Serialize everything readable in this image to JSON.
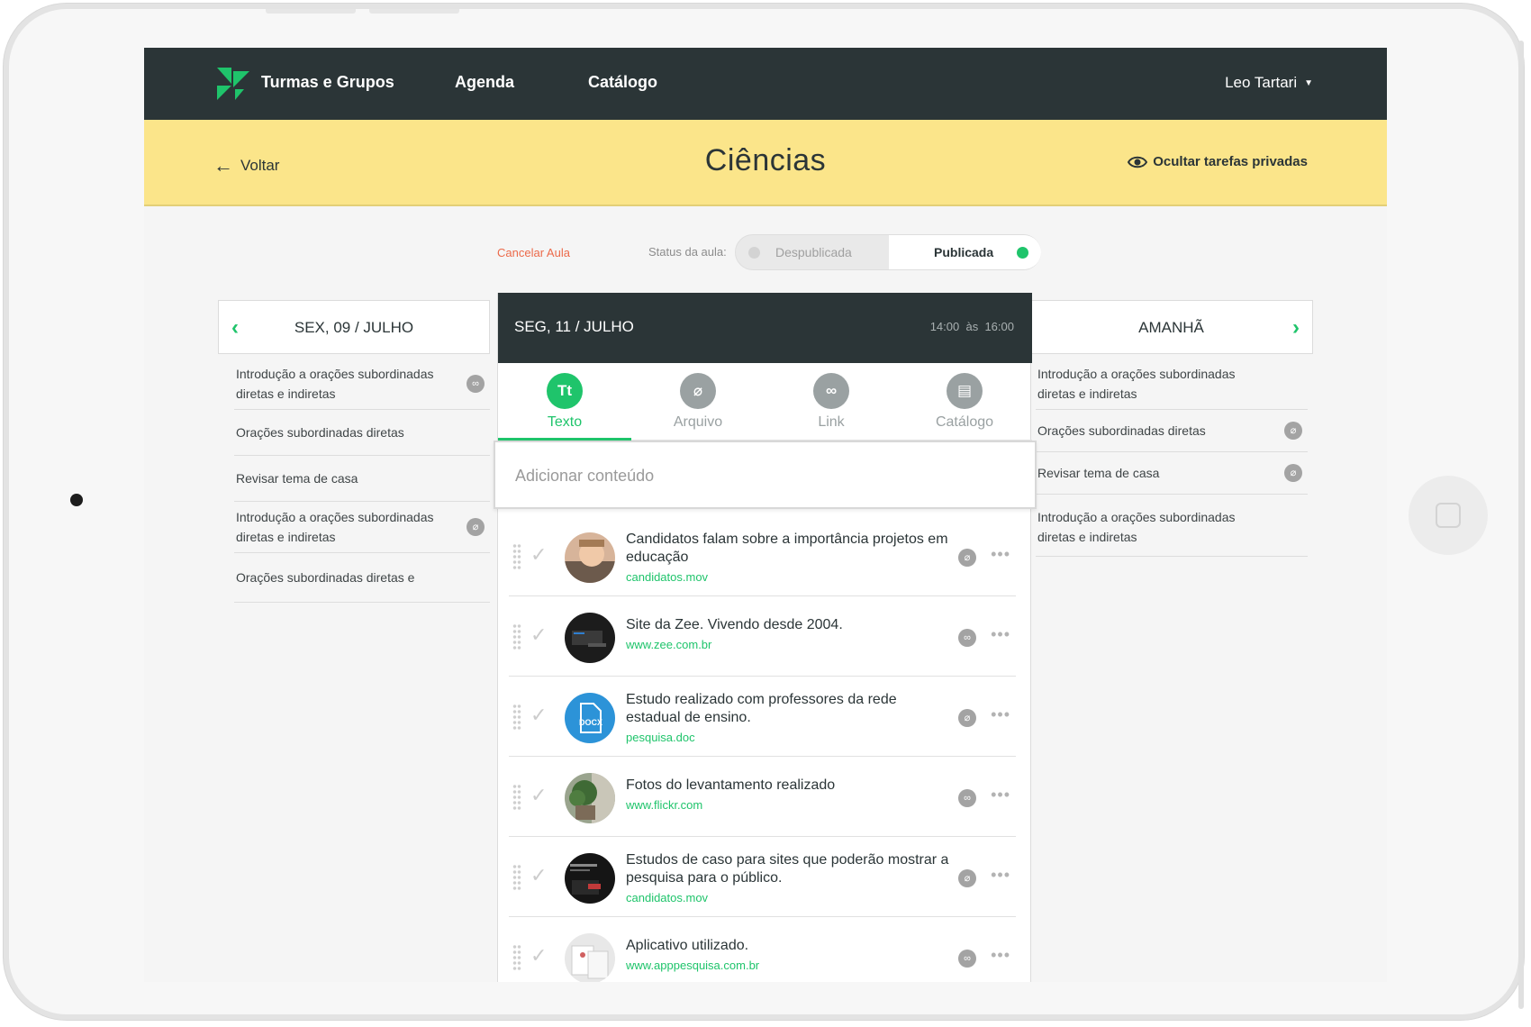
{
  "nav": {
    "brand": "Turmas e Grupos",
    "items": [
      "Agenda",
      "Catálogo"
    ],
    "user": "Leo Tartari"
  },
  "header": {
    "back": "Voltar",
    "title": "Ciências",
    "hide_private": "Ocultar tarefas privadas"
  },
  "status": {
    "cancel": "Cancelar Aula",
    "label": "Status da aula:",
    "off": "Despublicada",
    "on": "Publicada"
  },
  "left_day": {
    "title": "SEX, 09 / JULHO",
    "items": [
      {
        "text": "Introdução a orações subordinadas diretas e indiretas",
        "icon": "link-icon"
      },
      {
        "text": "Orações subordinadas diretas",
        "icon": ""
      },
      {
        "text": "Revisar tema de casa",
        "icon": ""
      },
      {
        "text": "Introdução a orações subordinadas diretas e indiretas",
        "icon": "paperclip-icon"
      },
      {
        "text": "Orações subordinadas diretas e",
        "icon": ""
      }
    ]
  },
  "right_day": {
    "title": "AMANHÃ",
    "items": [
      {
        "text": "Introdução a orações subordinadas diretas e indiretas",
        "icon": ""
      },
      {
        "text": "Orações subordinadas diretas",
        "icon": "paperclip-icon"
      },
      {
        "text": "Revisar tema de casa",
        "icon": "paperclip-icon"
      },
      {
        "text": "Introdução a orações subordinadas diretas e indiretas",
        "icon": ""
      }
    ]
  },
  "center": {
    "date": "SEG, 11 / JULHO",
    "time_start": "14:00",
    "time_sep": "às",
    "time_end": "16:00",
    "tabs": [
      {
        "label": "Texto",
        "glyph": "Tt",
        "active": true
      },
      {
        "label": "Arquivo",
        "glyph": "⌀",
        "active": false
      },
      {
        "label": "Link",
        "glyph": "∞",
        "active": false
      },
      {
        "label": "Catálogo",
        "glyph": "▤",
        "active": false
      }
    ],
    "add_placeholder": "Adicionar conteúdo",
    "items": [
      {
        "title": "Candidatos falam sobre a importância projetos em educação",
        "link": "candidatos.mov",
        "icon": "paperclip-icon",
        "thumb": "child-photo"
      },
      {
        "title": "Site da Zee. Vivendo desde 2004.",
        "link": "www.zee.com.br",
        "icon": "link-icon",
        "thumb": "website-dark"
      },
      {
        "title": "Estudo realizado com professores da rede estadual de ensino.",
        "link": "pesquisa.doc",
        "icon": "paperclip-icon",
        "thumb": "docx-icon"
      },
      {
        "title": "Fotos do levantamento realizado",
        "link": "www.flickr.com",
        "icon": "link-icon",
        "thumb": "plant-photo"
      },
      {
        "title": "Estudos de caso para sites que poderão mostrar a pesquisa para o público.",
        "link": "candidatos.mov",
        "icon": "paperclip-icon",
        "thumb": "website-dark"
      },
      {
        "title": "Aplicativo utilizado.",
        "link": "www.apppesquisa.com.br",
        "icon": "link-icon",
        "thumb": "app-screens"
      }
    ]
  },
  "colors": {
    "nav_bg": "#2b3537",
    "header_bg": "#fbe58a",
    "accent": "#1fc46b",
    "cancel": "#ec6a4a"
  }
}
